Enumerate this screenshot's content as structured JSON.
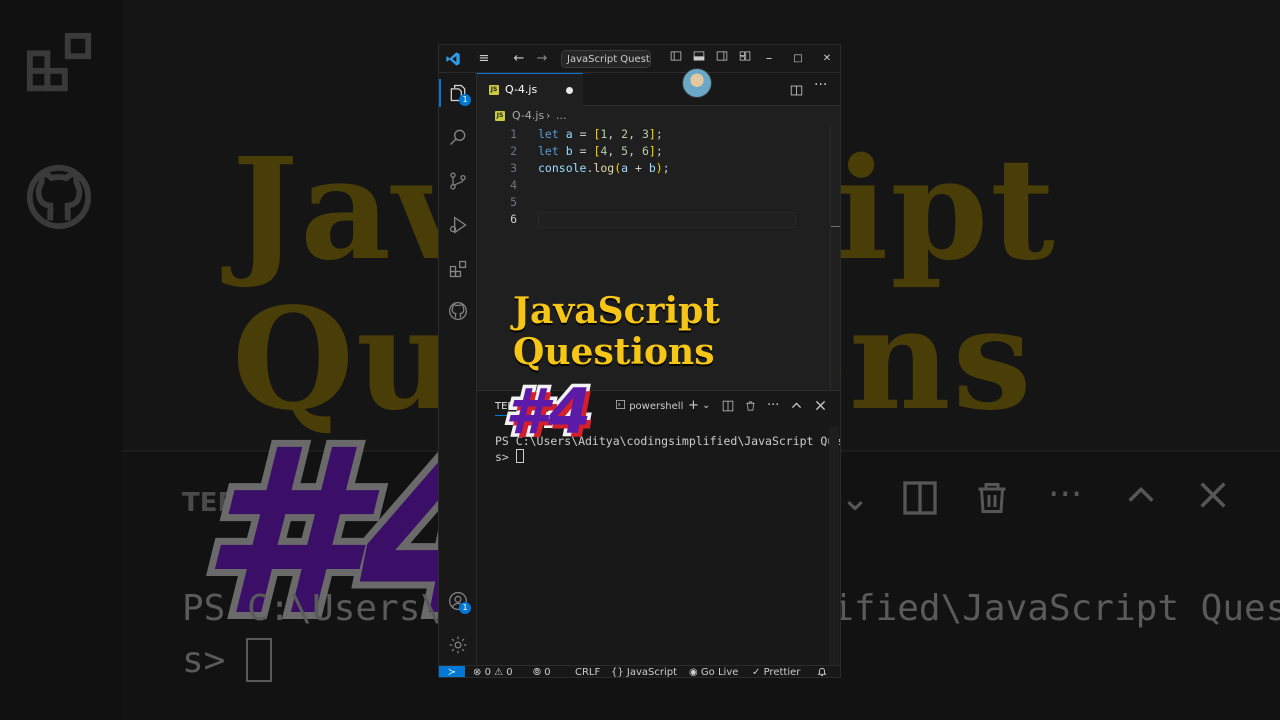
{
  "background": {
    "big_text_line1": "JavaScript",
    "big_text_line2": "Questions",
    "hash_text": "#4",
    "terminal_line1": "PS C:\\Users\\Aditya\\codingsimplified\\JavaScript Question",
    "terminal_line2": "s> ",
    "panel_tab": "TERMINAL"
  },
  "titlebar": {
    "search_text": "JavaScript Questions",
    "nav_back": "←",
    "nav_forward": "→",
    "menu": "≡",
    "min": "–",
    "max": "□",
    "close": "✕"
  },
  "activity_bar": {
    "explorer_badge": "1",
    "accounts_badge": "1"
  },
  "editor": {
    "tab_label": "Q-4.js",
    "breadcrumb_file": "Q-4.js",
    "breadcrumb_sep": "›",
    "breadcrumb_more": "...",
    "line_numbers": [
      "1",
      "2",
      "3",
      "4",
      "5",
      "6"
    ],
    "lines": {
      "l1_kw": "let",
      "l1_var": "a",
      "l1_rest1": " = ",
      "l1_open": "[",
      "l1_n1": "1",
      "l1_c1": ", ",
      "l1_n2": "2",
      "l1_c2": ", ",
      "l1_n3": "3",
      "l1_close": "]",
      "l1_end": ";",
      "l2_kw": "let",
      "l2_var": "b",
      "l2_rest1": " = ",
      "l2_open": "[",
      "l2_n1": "4",
      "l2_c1": ", ",
      "l2_n2": "5",
      "l2_c2": ", ",
      "l2_n3": "6",
      "l2_close": "]",
      "l2_end": ";",
      "l3_obj": "console",
      "l3_dot": ".",
      "l3_fn": "log",
      "l3_open": "(",
      "l3_a": "a",
      "l3_plus": " + ",
      "l3_b": "b",
      "l3_close": ")",
      "l3_end": ";"
    }
  },
  "overlay": {
    "title_line1": "JavaScript",
    "title_line2": "Questions",
    "number": "#4"
  },
  "panel": {
    "tab_label": "TERMINAL",
    "terminal_name": "powershell",
    "terminal_line1": "PS C:\\Users\\Aditya\\codingsimplified\\JavaScript Question",
    "terminal_line2": "s> "
  },
  "statusbar": {
    "remote": "≻",
    "errors": "0",
    "warnings": "0",
    "ports": "0",
    "eol": "CRLF",
    "language": "JavaScript",
    "go_live": "Go Live",
    "prettier": "Prettier"
  }
}
